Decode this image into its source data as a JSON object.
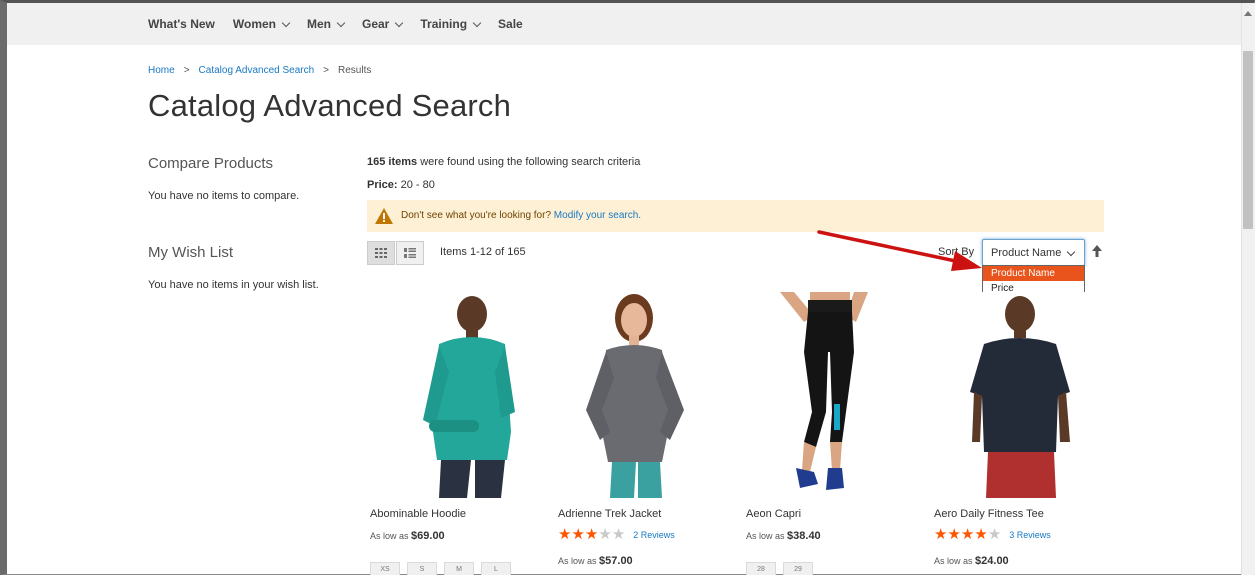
{
  "nav": {
    "items": [
      {
        "label": "What's New",
        "has_chevron": false
      },
      {
        "label": "Women",
        "has_chevron": true
      },
      {
        "label": "Men",
        "has_chevron": true
      },
      {
        "label": "Gear",
        "has_chevron": true
      },
      {
        "label": "Training",
        "has_chevron": true
      },
      {
        "label": "Sale",
        "has_chevron": false
      }
    ]
  },
  "breadcrumb": {
    "home": "Home",
    "catalog": "Catalog Advanced Search",
    "sep": ">",
    "current": "Results"
  },
  "page_title": "Catalog Advanced Search",
  "sidebar": {
    "compare_title": "Compare Products",
    "compare_text": "You have no items to compare.",
    "wishlist_title": "My Wish List",
    "wishlist_text": "You have no items in your wish list."
  },
  "summary": {
    "count": "165 items",
    "criteria_text": "were found using the following search criteria",
    "price_label": "Price:",
    "price_value": "20 - 80"
  },
  "notice": {
    "text": "Don't see what you're looking for?",
    "link": "Modify your search."
  },
  "toolbar": {
    "items_count": "Items 1-12 of 165",
    "sort_label": "Sort By",
    "sort_selected": "Product Name",
    "sort_options": [
      "Product Name",
      "Price"
    ]
  },
  "products": [
    {
      "name": "Abominable Hoodie",
      "as_low_as": "As low as",
      "price": "$69.00",
      "rating": 0,
      "reviews": "",
      "sizes": [
        "XS",
        "S",
        "M",
        "L"
      ]
    },
    {
      "name": "Adrienne Trek Jacket",
      "as_low_as": "As low as",
      "price": "$57.00",
      "rating": 3,
      "reviews": "2 Reviews",
      "sizes": []
    },
    {
      "name": "Aeon Capri",
      "as_low_as": "As low as",
      "price": "$38.40",
      "rating": 0,
      "reviews": "",
      "sizes": [
        "28",
        "29"
      ]
    },
    {
      "name": "Aero Daily Fitness Tee",
      "as_low_as": "As low as",
      "price": "$24.00",
      "rating": 4,
      "reviews": "3 Reviews",
      "sizes": []
    }
  ],
  "colors": {
    "link": "#1979c3",
    "notice_bg": "#fdf0d5",
    "star_on": "#ff5501",
    "selected_option": "#e8541c",
    "annotation_arrow": "#cc1111"
  }
}
